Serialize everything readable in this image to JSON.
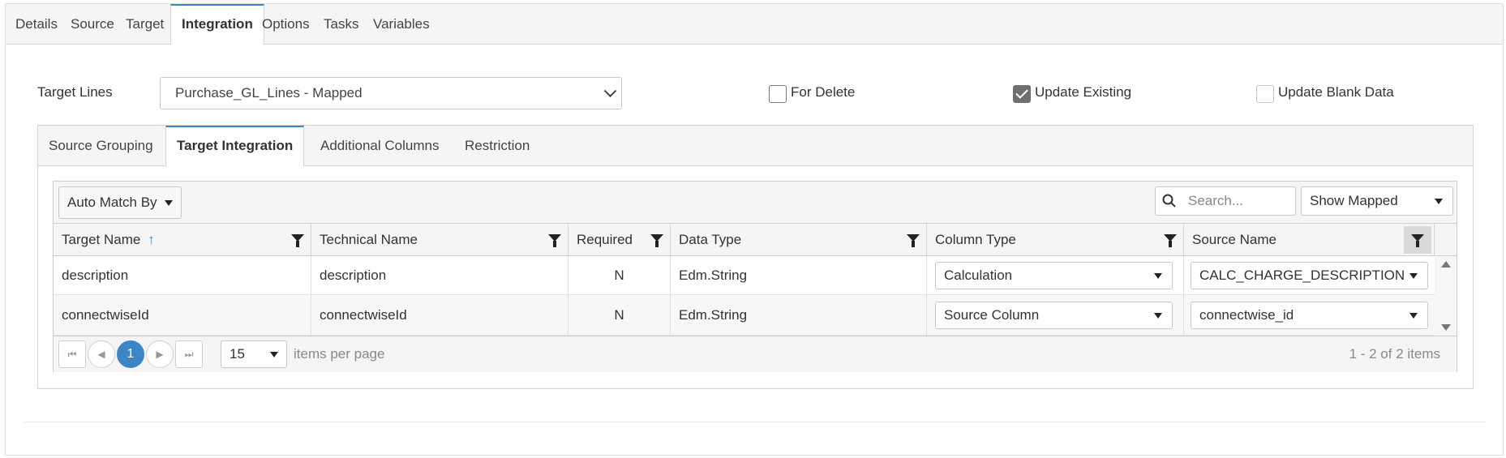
{
  "top_tabs": [
    {
      "label": "Details",
      "active": false
    },
    {
      "label": "Source",
      "active": false
    },
    {
      "label": "Target",
      "active": false
    },
    {
      "label": "Integration",
      "active": true
    },
    {
      "label": "Options",
      "active": false
    },
    {
      "label": "Tasks",
      "active": false
    },
    {
      "label": "Variables",
      "active": false
    }
  ],
  "target_lines": {
    "label": "Target Lines",
    "selected": "Purchase_GL_Lines - Mapped"
  },
  "checkboxes": {
    "for_delete": {
      "label": "For Delete",
      "checked": false
    },
    "update_existing": {
      "label": "Update Existing",
      "checked": true
    },
    "update_blank_data": {
      "label": "Update Blank Data",
      "checked": false,
      "disabled": true
    }
  },
  "inner_tabs": [
    {
      "label": "Source Grouping",
      "active": false
    },
    {
      "label": "Target Integration",
      "active": true
    },
    {
      "label": "Additional Columns",
      "active": false
    },
    {
      "label": "Restriction",
      "active": false
    }
  ],
  "toolbar": {
    "auto_match_label": "Auto Match By",
    "search_placeholder": "Search...",
    "show_filter": "Show Mapped"
  },
  "grid": {
    "columns": [
      "Target Name",
      "Technical Name",
      "Required",
      "Data Type",
      "Column Type",
      "Source Name"
    ],
    "sort_indicator": "↑",
    "rows": [
      {
        "target_name": "description",
        "technical_name": "description",
        "required": "N",
        "data_type": "Edm.String",
        "column_type": "Calculation",
        "source_name": "CALC_CHARGE_DESCRIPTION"
      },
      {
        "target_name": "connectwiseId",
        "technical_name": "connectwiseId",
        "required": "N",
        "data_type": "Edm.String",
        "column_type": "Source Column",
        "source_name": "connectwise_id"
      }
    ]
  },
  "pager": {
    "current_page": "1",
    "page_size": "15",
    "items_per_page_label": "items per page",
    "summary": "1 - 2 of 2 items"
  },
  "colors": {
    "accent": "#3d86c6",
    "tab_bg": "#f5f5f5",
    "border": "#d5d5d5"
  }
}
